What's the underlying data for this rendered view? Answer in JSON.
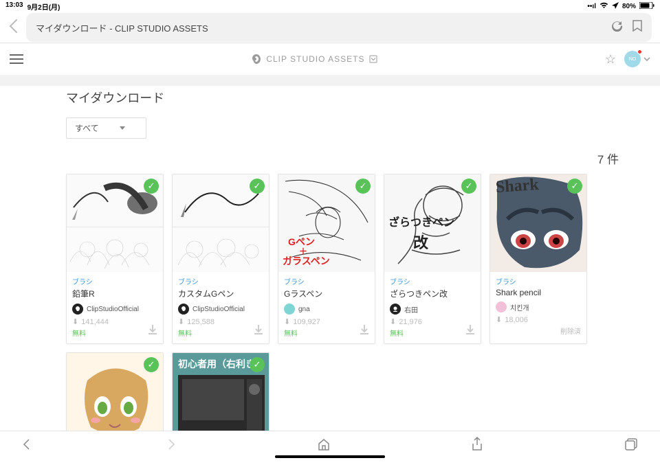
{
  "status": {
    "time": "13:03",
    "date": "9月2日(月)",
    "battery": "80%"
  },
  "browser": {
    "title": "マイダウンロード - CLIP STUDIO ASSETS"
  },
  "header": {
    "brand": "CLIP STUDIO ASSETS"
  },
  "page": {
    "title": "マイダウンロード",
    "filter": "すべて",
    "count": "7 件"
  },
  "cards": [
    {
      "cat": "ブラシ",
      "title": "鉛筆R",
      "author": "ClipStudioOfficial",
      "downloads": "141,444",
      "price": "無料"
    },
    {
      "cat": "ブラシ",
      "title": "カスタムGペン",
      "author": "ClipStudioOfficial",
      "downloads": "125,588",
      "price": "無料"
    },
    {
      "cat": "ブラシ",
      "title": "Gラスペン",
      "author": "gna",
      "downloads": "109,927",
      "price": "無料"
    },
    {
      "cat": "ブラシ",
      "title": "ざらつきペン改",
      "author": "右田",
      "downloads": "21,976",
      "price": "無料"
    },
    {
      "cat": "ブラシ",
      "title": "Shark pencil",
      "author": "치킨개",
      "downloads": "18,006",
      "deleted": "削除済"
    }
  ],
  "thumb_labels": {
    "gpen": "Gペン",
    "gpen_plus": "＋",
    "glass": "ガラスペン",
    "zaratuki1": "ざらつきペン",
    "zaratuki2": "改",
    "shark": "Shark",
    "row2": "初心者用（右利き"
  }
}
